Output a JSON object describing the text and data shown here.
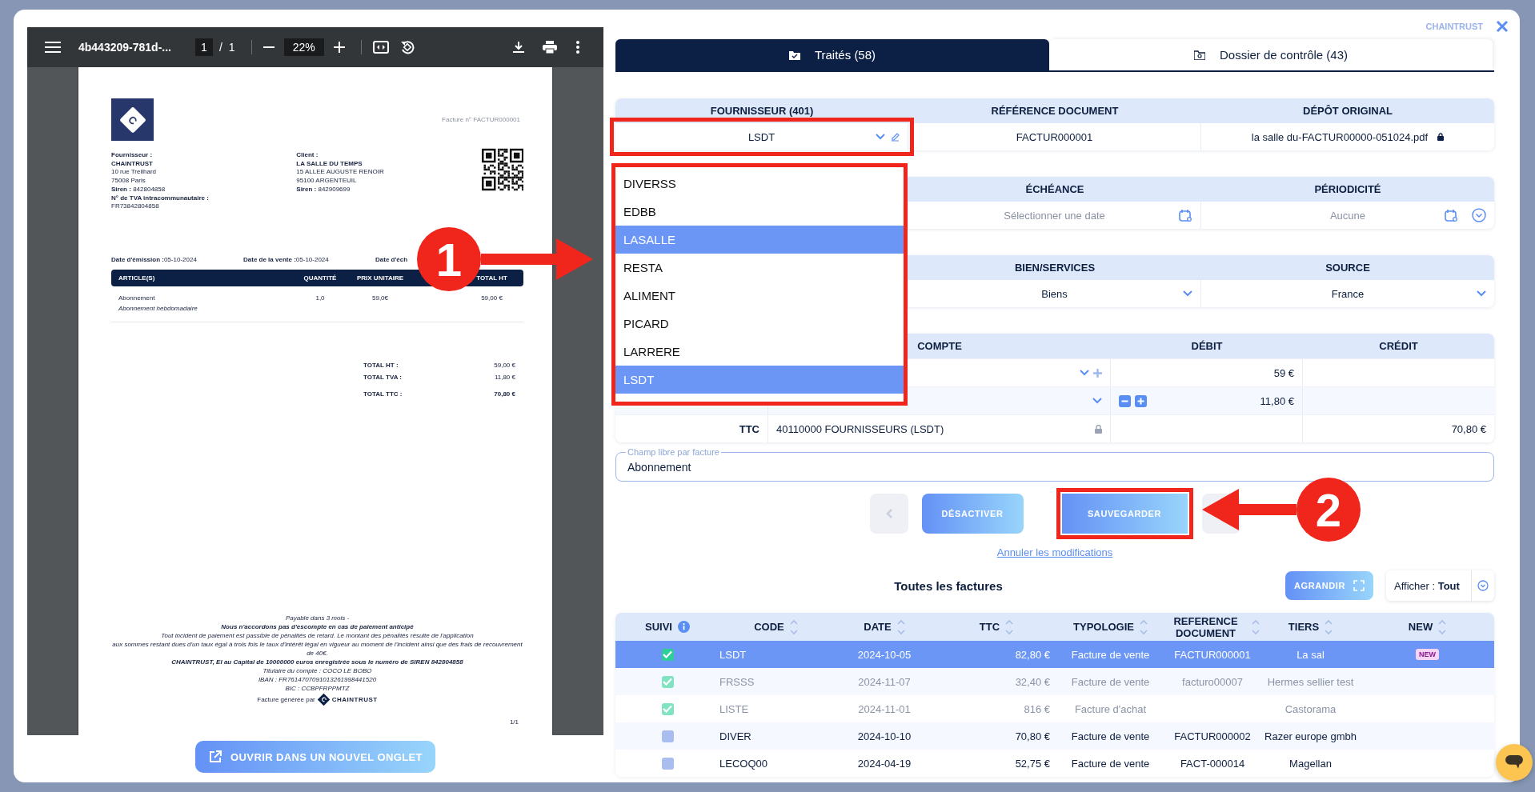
{
  "pdf_viewer": {
    "file_name": "4b443209-781d-...",
    "page": "1",
    "page_separator": "/",
    "page_count": "1",
    "zoom": "22%"
  },
  "invoice": {
    "logo_mark": "C",
    "number": "Facture n° FACTUR000001",
    "supplier": [
      {
        "text": "Fournisseur :",
        "bold": true
      },
      {
        "text": "CHAINTRUST",
        "bold": true
      },
      {
        "text": "10 rue Treilhard",
        "bold": false
      },
      {
        "text": "75008 Paris",
        "bold": false
      },
      {
        "text": "**Siren :** 842804858",
        "bold": false
      },
      {
        "text": "N° de TVA intracommunautaire :",
        "bold": true
      },
      {
        "text": "FR73842804858",
        "bold": false
      }
    ],
    "client": [
      {
        "text": "Client :",
        "bold": true
      },
      {
        "text": "LA SALLE DU TEMPS",
        "bold": true
      },
      {
        "text": "15 ALLEE AUGUSTE RENOIR",
        "bold": false
      },
      {
        "text": "95100 ARGENTEUIL",
        "bold": false
      },
      {
        "text": "**Siren :** 842909699",
        "bold": false
      }
    ],
    "dates": [
      {
        "label": "Date d'émission :",
        "value": "05-10-2024"
      },
      {
        "label": "Date de la vente :",
        "value": "05-10-2024"
      },
      {
        "label": "Date d'éch"
      }
    ],
    "columns": [
      "ARTICLE(S)",
      "QUANTITÉ",
      "PRIX UNITAIRE",
      "TOTAL HT"
    ],
    "items": [
      {
        "name": "Abonnement",
        "description": "Abonnement hebdomadaire",
        "quantity": "1,0",
        "unit_price": "59,0€",
        "total": "59,00 €"
      }
    ],
    "totals": [
      {
        "label": "TOTAL HT :",
        "value": "59,00 €",
        "bold": false
      },
      {
        "label": "TOTAL TVA :",
        "value": "11,80 €",
        "bold": false
      },
      {
        "label": "TOTAL TTC :",
        "value": "70,80 €",
        "bold": true
      }
    ],
    "footer": [
      {
        "text": "Payable dans 3 mois -",
        "kind": "plain"
      },
      {
        "text": "Nous n'accordons pas d'escompte en cas de paiement anticipé",
        "kind": "strong"
      },
      {
        "text": "Tout incident de paiement est passible de pénalités de retard. Le montant des pénalités résulte de l'application",
        "kind": "plain"
      },
      {
        "text": "aux sommes restant dues d'un taux égal à trois fois le taux d'intérêt légal en vigueur au moment de l'incident ainsi que des frais de recouvrement de 40€.",
        "kind": "plain"
      },
      {
        "text": "CHAINTRUST, EI au Capital de 10000000 euros enregistrée sous le numéro de SIREN 842804858",
        "kind": "strong"
      },
      {
        "text": "Titulaire du compte : COCO LE BOBO",
        "kind": "plain"
      },
      {
        "text": "IBAN : FR7614707091013261998441520",
        "kind": "plain"
      },
      {
        "text": "BIC : CCBPFRPPMTZ",
        "kind": "plain"
      }
    ],
    "generated_by": "Facture générée par",
    "generator_logo_mark": "C",
    "generator_brand": "CHAINTRUST",
    "page_number": "1/1"
  },
  "open_tab_button": "OUVRIR DANS UN NOUVEL ONGLET",
  "brand": "CHAINTRUST",
  "tabs": [
    {
      "label": "Traités (58)",
      "selected": true
    },
    {
      "label": "Dossier de contrôle (43)",
      "selected": false
    }
  ],
  "supplier": {
    "header": "FOURNISSEUR (401)",
    "value": "LSDT",
    "open": true,
    "options": [
      {
        "label": "DIVERSS",
        "selected": false
      },
      {
        "label": "EDBB",
        "selected": false
      },
      {
        "label": "LASALLE",
        "selected": true
      },
      {
        "label": "RESTA",
        "selected": false
      },
      {
        "label": "ALIMENT",
        "selected": false
      },
      {
        "label": "PICARD",
        "selected": false
      },
      {
        "label": "LARRERE",
        "selected": false
      },
      {
        "label": "LSDT",
        "selected": true
      }
    ]
  },
  "reference": {
    "header": "RÉFÉRENCE DOCUMENT",
    "value": "FACTUR000001"
  },
  "original_file": {
    "header": "DÉPÔT ORIGINAL",
    "value": "la salle du-FACTUR00000-051024.pdf",
    "locked": true
  },
  "due_date": {
    "header": "ÉCHÉANCE",
    "placeholder": "Sélectionner une date"
  },
  "periodicity": {
    "header": "PÉRIODICITÉ",
    "placeholder": "Aucune"
  },
  "goods_services": {
    "header": "BIEN/SERVICES",
    "value": "Biens"
  },
  "source": {
    "header": "SOURCE",
    "value": "France"
  },
  "entries": {
    "columns": [
      "COMPTE",
      "DÉBIT",
      "CRÉDIT"
    ],
    "rows": [
      {
        "kind": "expense",
        "debit": "59 €"
      },
      {
        "kind": "vat",
        "debit": "11,80 €"
      },
      {
        "kind": "total",
        "label": "TTC",
        "account": "40110000 FOURNISSEURS (LSDT)",
        "locked": true,
        "credit": "70,80 €"
      }
    ]
  },
  "free_field": {
    "label": "Champ libre par facture",
    "value": "Abonnement"
  },
  "actions": {
    "deactivate": "DÉSACTIVER",
    "save": "SAUVEGARDER",
    "cancel": "Annuler les modifications"
  },
  "invoices": {
    "title": "Toutes les factures",
    "expand": "AGRANDIR",
    "filter_label": "Afficher :",
    "filter_value": "Tout",
    "columns": [
      {
        "label": "SUIVI",
        "info": true,
        "sortable": false
      },
      {
        "label": "CODE",
        "info": false,
        "sortable": true
      },
      {
        "label": "DATE",
        "info": false,
        "sortable": true
      },
      {
        "label": "TTC",
        "info": false,
        "sortable": true
      },
      {
        "label": "TYPOLOGIE",
        "info": false,
        "sortable": true
      },
      {
        "label": "REFERENCE DOCUMENT",
        "info": false,
        "sortable": true
      },
      {
        "label": "TIERS",
        "info": false,
        "sortable": true
      },
      {
        "label": "NEW",
        "info": false,
        "sortable": true
      }
    ],
    "rows": [
      {
        "checked": true,
        "selected": true,
        "dimmed": false,
        "code": "LSDT",
        "date": "2024-10-05",
        "ttc": "82,80 €",
        "typology": "Facture de vente",
        "reference": "FACTUR000001",
        "tiers": "La sal",
        "badge": "NEW"
      },
      {
        "checked": true,
        "selected": false,
        "dimmed": true,
        "code": "FRSSS",
        "date": "2024-11-07",
        "ttc": "32,40 €",
        "typology": "Facture de vente",
        "reference": "facturo00007",
        "tiers": "Hermes sellier test"
      },
      {
        "checked": true,
        "selected": false,
        "dimmed": true,
        "code": "LISTE",
        "date": "2024-11-01",
        "ttc": "816 €",
        "typology": "Facture d'achat",
        "tiers": "Castorama"
      },
      {
        "checked": false,
        "selected": false,
        "dimmed": false,
        "code": "DIVER",
        "date": "2024-10-10",
        "ttc": "70,80 €",
        "typology": "Facture de vente",
        "reference": "FACTUR000002",
        "tiers": "Razer europe gmbh"
      },
      {
        "checked": false,
        "selected": false,
        "dimmed": false,
        "code": "LECOQ00",
        "date": "2024-04-19",
        "ttc": "52,75 €",
        "typology": "Facture de vente",
        "reference": "FACT-000014",
        "tiers": "Magellan"
      }
    ]
  },
  "annotations": [
    {
      "label": "1"
    },
    {
      "label": "2"
    }
  ]
}
